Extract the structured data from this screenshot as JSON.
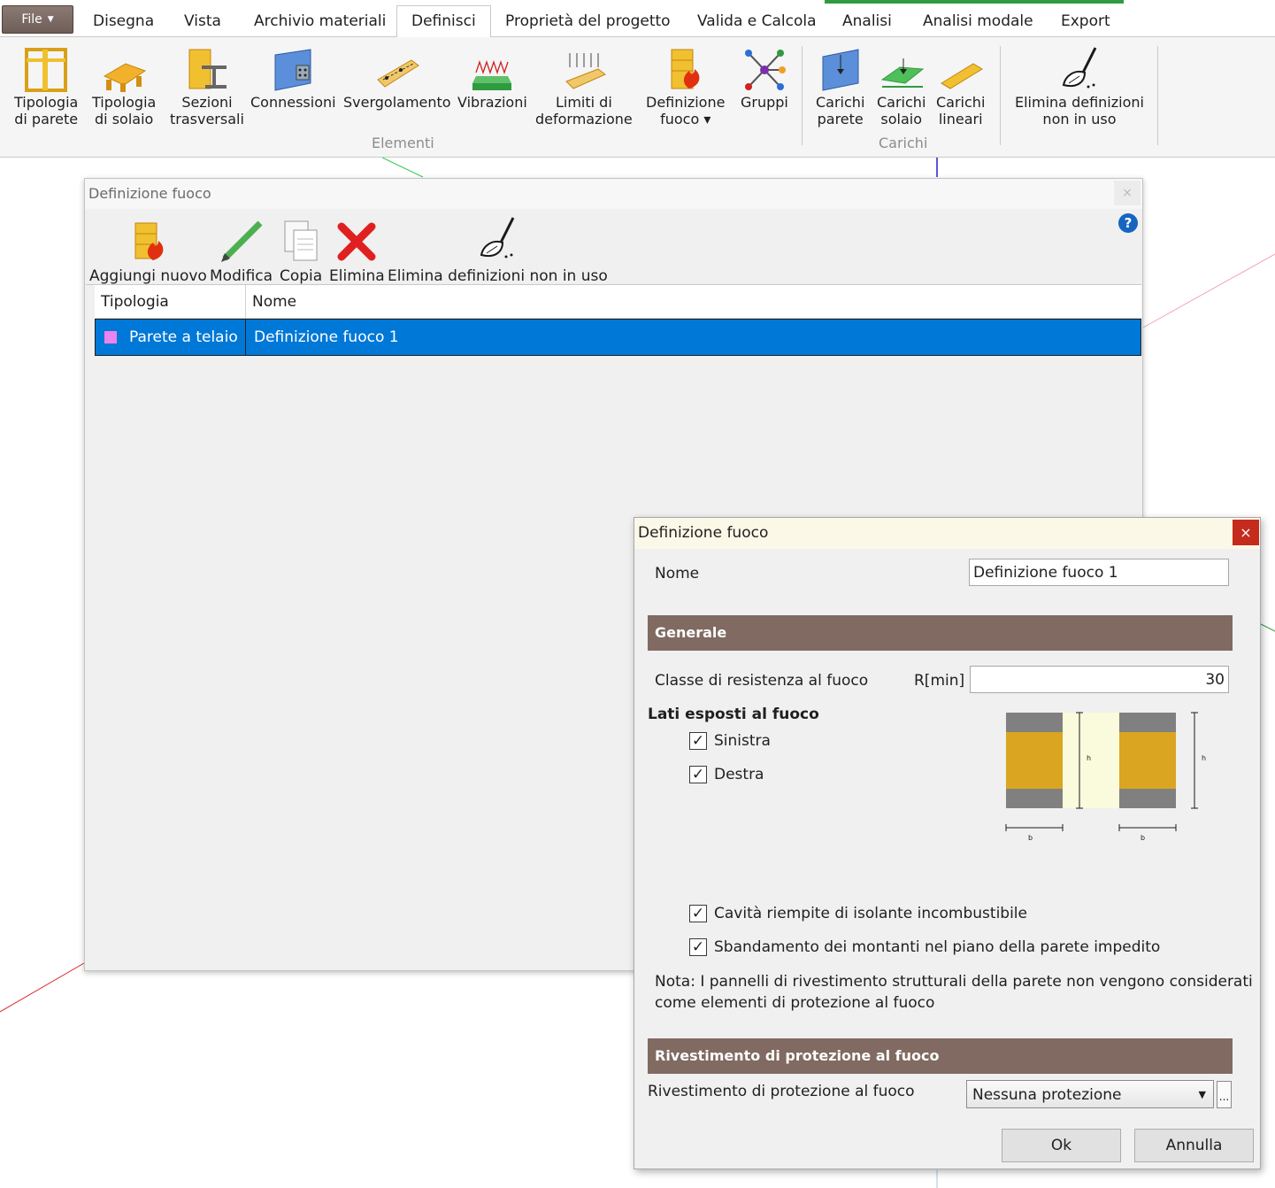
{
  "ribbon": {
    "file_label": "File",
    "tabs": [
      {
        "label": "Disegna"
      },
      {
        "label": "Vista"
      },
      {
        "label": "Archivio materiali"
      },
      {
        "label": "Definisci"
      },
      {
        "label": "Proprietà del progetto"
      },
      {
        "label": "Valida e Calcola"
      },
      {
        "label": "Analisi"
      },
      {
        "label": "Analisi modale"
      },
      {
        "label": "Export"
      }
    ],
    "buttons": [
      {
        "line1": "Tipologia",
        "line2": "di parete"
      },
      {
        "line1": "Tipologia",
        "line2": "di solaio"
      },
      {
        "line1": "Sezioni",
        "line2": "trasversali"
      },
      {
        "line1": "Connessioni",
        "line2": ""
      },
      {
        "line1": "Svergolamento",
        "line2": ""
      },
      {
        "line1": "Vibrazioni",
        "line2": ""
      },
      {
        "line1": "Limiti di",
        "line2": "deformazione"
      },
      {
        "line1": "Definizione",
        "line2": "fuoco ▾"
      },
      {
        "line1": "Gruppi",
        "line2": ""
      },
      {
        "line1": "Carichi",
        "line2": "parete"
      },
      {
        "line1": "Carichi",
        "line2": "solaio"
      },
      {
        "line1": "Carichi",
        "line2": "lineari"
      },
      {
        "line1": "Elimina definizioni",
        "line2": "non in uso"
      }
    ],
    "groups": {
      "elementi": "Elementi",
      "carichi": "Carichi"
    }
  },
  "main_dialog": {
    "title": "Definizione fuoco",
    "close": "×",
    "help": "?",
    "toolbar": {
      "add": "Aggiungi nuovo",
      "edit": "Modifica",
      "copy": "Copia",
      "delete": "Elimina",
      "cleanup": "Elimina definizioni non in uso"
    },
    "columns": [
      "Tipologia",
      "Nome"
    ],
    "rows": [
      {
        "tipologia": "Parete a telaio",
        "nome": "Definizione fuoco 1",
        "color": "#ee82ee"
      }
    ]
  },
  "fire_dialog": {
    "title": "Definizione fuoco",
    "close": "×",
    "name_label": "Nome",
    "name_value": "Definizione fuoco 1",
    "section_general": "Generale",
    "resistance_label": "Classe di resistenza al fuoco",
    "resistance_unit": "R[min]",
    "resistance_value": "30",
    "exposed_label": "Lati esposti al fuoco",
    "left_label": "Sinistra",
    "right_label": "Destra",
    "diagram": {
      "h_label": "h",
      "b_label": "b"
    },
    "cavity_label": "Cavità riempite di isolante incombustibile",
    "buckling_label": "Sbandamento dei montanti nel piano della parete impedito",
    "note_line1": "Nota: I pannelli di rivestimento strutturali della parete non vengono considerati",
    "note_line2": "come elementi di protezione al fuoco",
    "section_cladding": "Rivestimento di protezione al fuoco",
    "cladding_label": "Rivestimento di protezione al fuoco",
    "cladding_value": "Nessuna protezione",
    "ellipsis": "...",
    "ok": "Ok",
    "cancel": "Annulla",
    "check_mark": "✓"
  }
}
